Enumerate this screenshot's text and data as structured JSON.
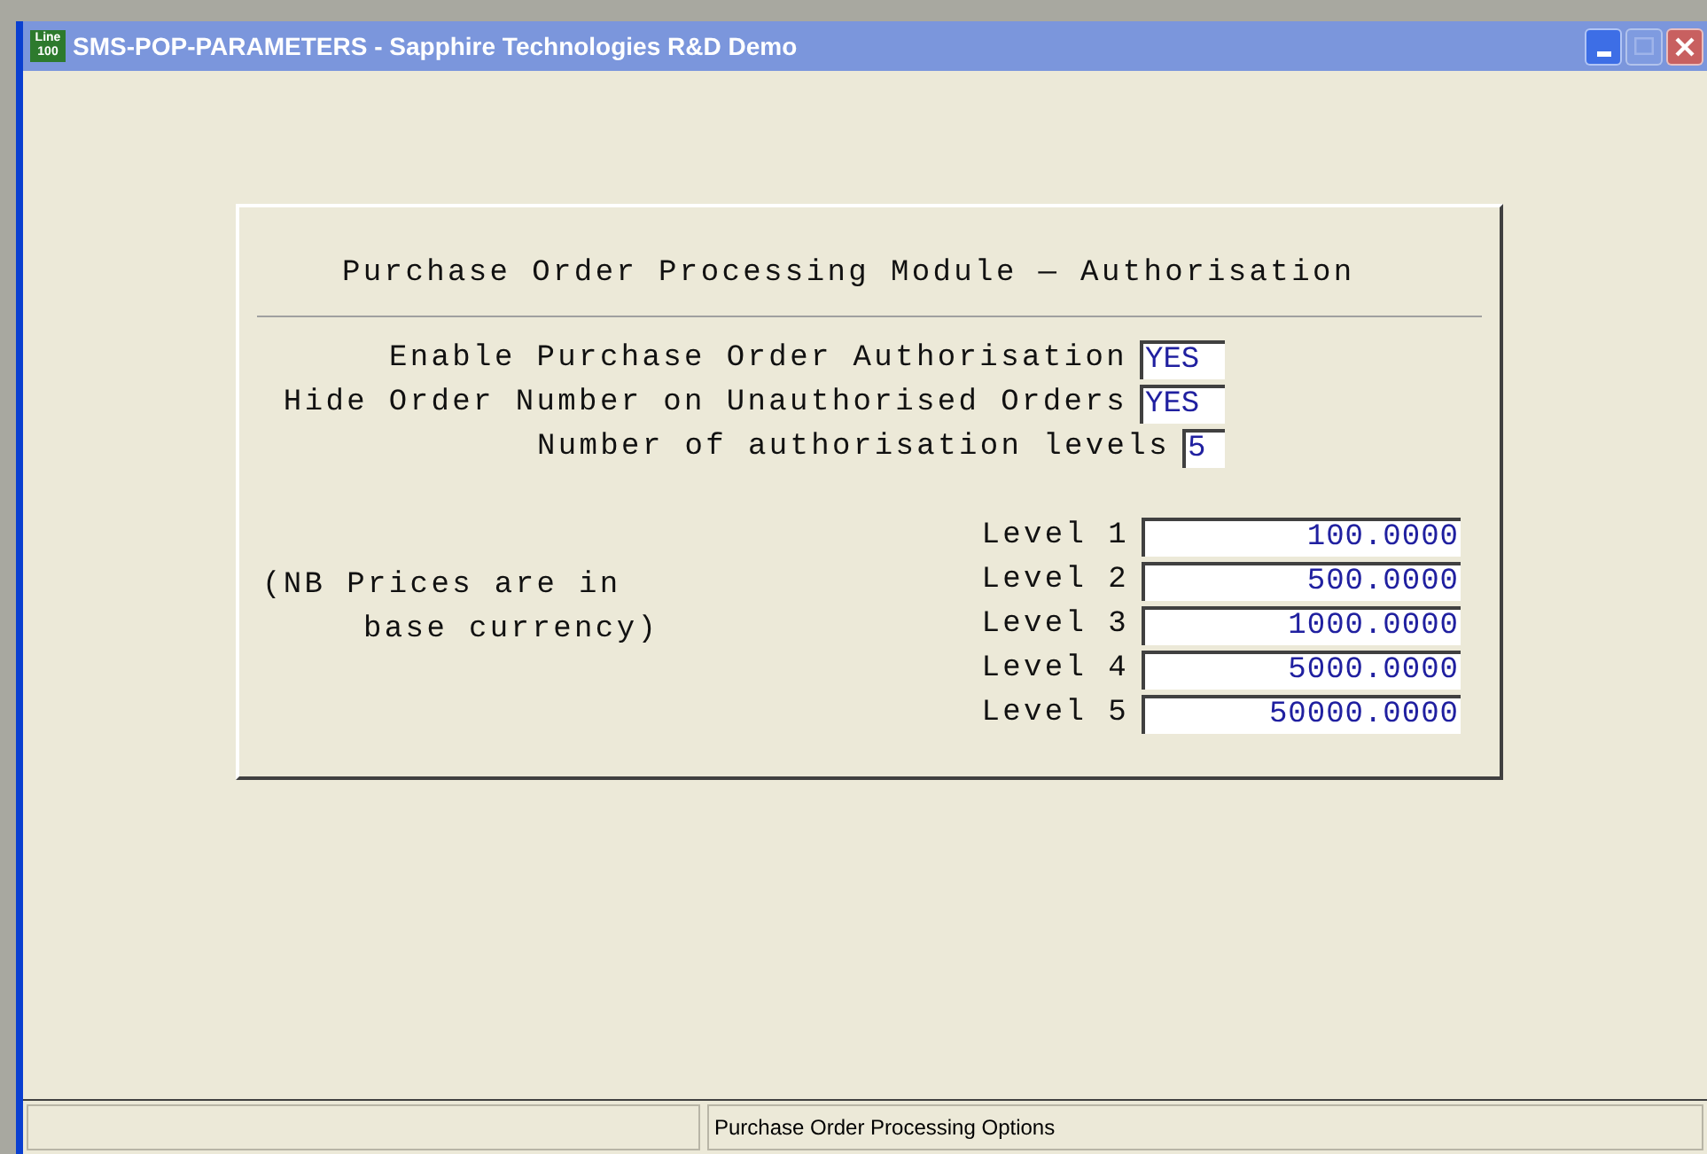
{
  "window": {
    "title": "SMS-POP-PARAMETERS - Sapphire Technologies R&D Demo",
    "app_icon": "Line 100"
  },
  "panel": {
    "heading": "Purchase Order Processing Module — Authorisation",
    "settings": [
      {
        "label": "Enable Purchase Order Authorisation",
        "value": "YES",
        "kind": "short"
      },
      {
        "label": "Hide Order Number on Unauthorised Orders",
        "value": "YES",
        "kind": "short"
      },
      {
        "label": "Number of authorisation levels",
        "value": "5",
        "kind": "tiny"
      }
    ],
    "note": "(NB Prices are in base currency)",
    "levels": [
      {
        "label": "Level 1",
        "value": "100.0000"
      },
      {
        "label": "Level 2",
        "value": "500.0000"
      },
      {
        "label": "Level 3",
        "value": "1000.0000"
      },
      {
        "label": "Level 4",
        "value": "5000.0000"
      },
      {
        "label": "Level 5",
        "value": "50000.0000"
      }
    ]
  },
  "status_bar": {
    "panel_2": "Purchase Order Processing Options"
  }
}
